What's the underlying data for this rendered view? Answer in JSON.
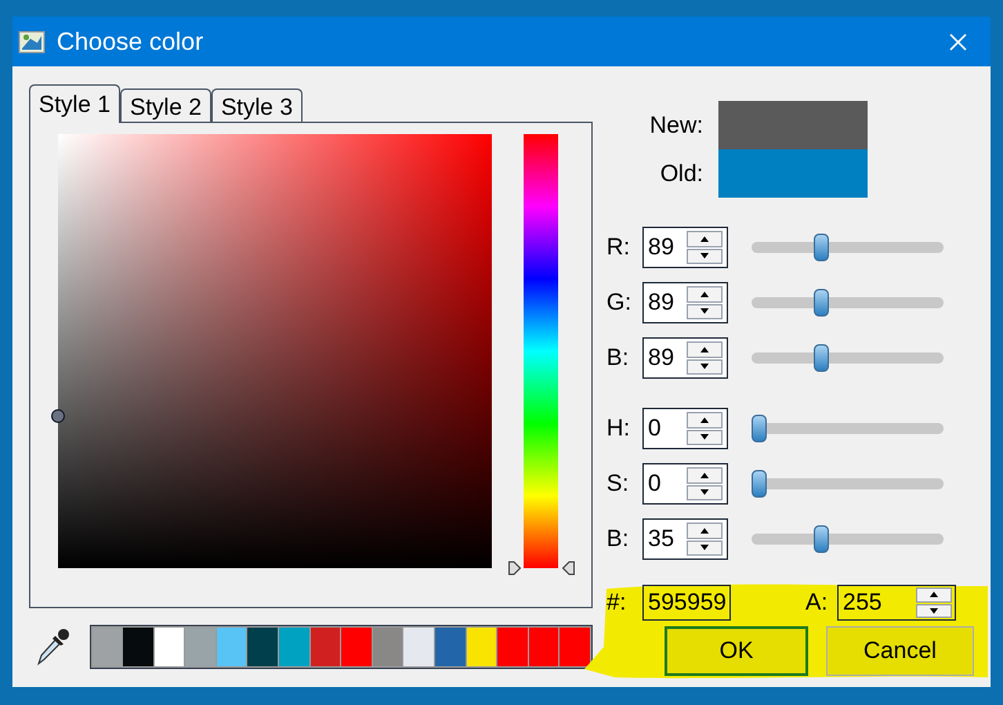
{
  "window": {
    "title": "Choose color"
  },
  "tabs": [
    {
      "label": "Style 1",
      "selected": true
    },
    {
      "label": "Style 2",
      "selected": false
    },
    {
      "label": "Style 3",
      "selected": false
    }
  ],
  "preview": [
    {
      "label": "New:",
      "color": "#5a5a5a"
    },
    {
      "label": "Old:",
      "color": "#0080c0"
    }
  ],
  "channels": [
    {
      "label": "R:",
      "value": "89",
      "level": 0.35
    },
    {
      "label": "G:",
      "value": "89",
      "level": 0.35
    },
    {
      "label": "B:",
      "value": "89",
      "level": 0.35
    },
    {
      "label": "H:",
      "value": "0",
      "level": 0
    },
    {
      "label": "S:",
      "value": "0",
      "level": 0
    },
    {
      "label": "B:",
      "value": "35",
      "level": 0.35
    }
  ],
  "hex": {
    "label": "#:",
    "value": "595959"
  },
  "alpha": {
    "label": "A:",
    "value": "255"
  },
  "swatches": [
    {
      "color": "#9ea2a4"
    },
    {
      "color": "#060b0e"
    },
    {
      "color": "#ffffff"
    },
    {
      "color": "#98a4a8"
    },
    {
      "color": "#58c3f5"
    },
    {
      "color": "#003f4b"
    },
    {
      "color": "#00a2c1"
    },
    {
      "color": "#d02020"
    },
    {
      "color": "#ff0000"
    },
    {
      "color": "#8a8886"
    },
    {
      "color": "#e6e8f0"
    },
    {
      "color": "#2265a8"
    },
    {
      "color": "#f8e400"
    },
    {
      "color": "#ff0000"
    },
    {
      "color": "#ff0000"
    },
    {
      "color": "#ff0000"
    }
  ],
  "buttons": [
    {
      "label": "OK",
      "focused": true
    },
    {
      "label": "Cancel",
      "focused": false
    }
  ]
}
